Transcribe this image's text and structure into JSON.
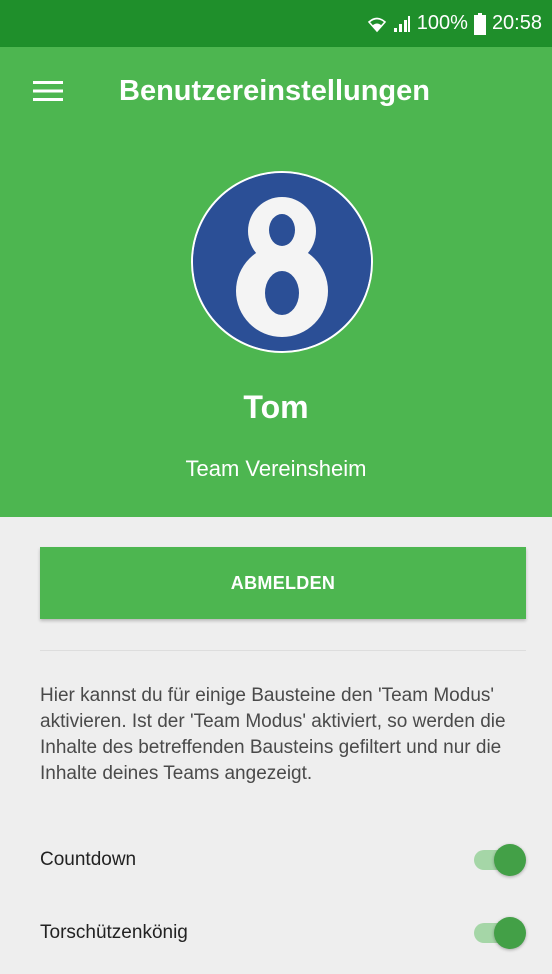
{
  "status_bar": {
    "battery": "100%",
    "time": "20:58",
    "wifi_icon": "wifi-icon",
    "signal_icon": "signal-icon",
    "battery_icon": "battery-icon"
  },
  "app_bar": {
    "menu_icon": "hamburger-menu-icon",
    "title": "Benutzereinstellungen"
  },
  "profile": {
    "avatar_icon": "number-eight-avatar",
    "name": "Tom",
    "team": "Team Vereinsheim"
  },
  "actions": {
    "logout_label": "ABMELDEN"
  },
  "team_mode": {
    "description": "Hier kannst du für einige Bausteine den 'Team Modus' aktivieren. Ist der 'Team Modus' aktiviert, so werden die Inhalte des betreffenden Bausteins gefiltert und nur die Inhalte deines Teams angezeigt.",
    "settings": [
      {
        "label": "Countdown",
        "enabled": true
      },
      {
        "label": "Torschützenkönig",
        "enabled": true
      }
    ]
  },
  "colors": {
    "status_bar": "#1f8f2b",
    "primary": "#4db650",
    "background": "#eeeeee",
    "toggle_thumb": "#43a047",
    "toggle_track": "#a5d6a7",
    "avatar_bg": "#2b4f96"
  }
}
